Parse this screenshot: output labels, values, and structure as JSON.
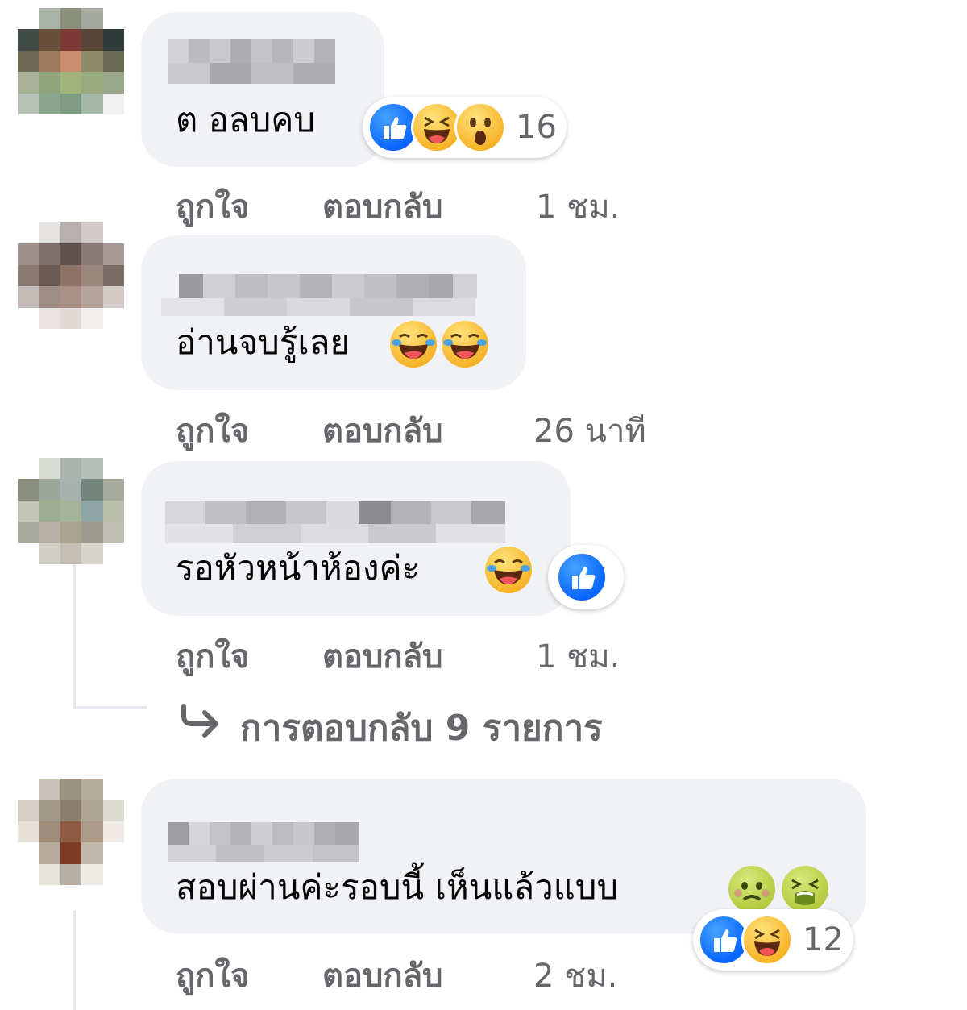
{
  "comments": [
    {
      "text": "ต อลบคบ",
      "reaction_count": "16",
      "like_label": "ถูกใจ",
      "reply_label": "ตอบกลับ",
      "time": "1 ชม."
    },
    {
      "text": "อ่านจบรู้เลย",
      "like_label": "ถูกใจ",
      "reply_label": "ตอบกลับ",
      "time": "26 นาที"
    },
    {
      "text": "รอหัวหน้าห้องค่ะ",
      "like_label": "ถูกใจ",
      "reply_label": "ตอบกลับ",
      "time": "1 ชม.",
      "replies_link": "การตอบกลับ 9 รายการ"
    },
    {
      "text": "สอบผ่านค่ะรอบนี้ เห็นแล้วแบบ",
      "reaction_count": "12",
      "like_label": "ถูกใจ",
      "reply_label": "ตอบกลับ",
      "time": "2 ชม."
    }
  ],
  "colors": {
    "bubble": "#f0f2f5",
    "meta_text": "#65676b",
    "like_blue": "#0866ff"
  },
  "icons": [
    "like-reaction-icon",
    "haha-reaction-icon",
    "wow-reaction-icon",
    "tears-of-joy-emoji-icon",
    "nauseated-emoji-icon",
    "reply-arrow-icon"
  ]
}
